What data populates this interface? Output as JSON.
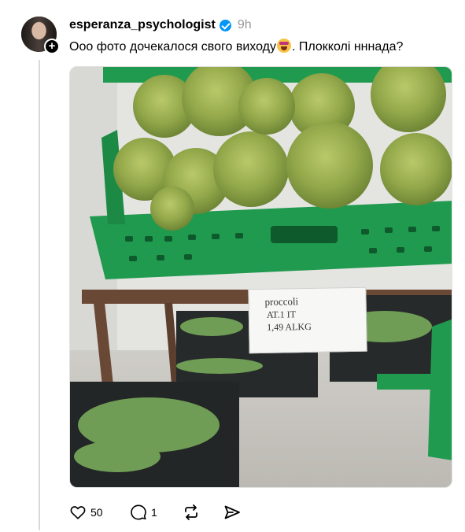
{
  "post": {
    "username": "esperanza_psychologist",
    "time": "9h",
    "text_before_emoji": "Ооо фото дочекалося свого виходу",
    "emoji": "smiling-face-with-hearts",
    "text_after_emoji": ". Плокколі нннада?",
    "photo": {
      "sign_lines": [
        "proccoli",
        "AT.1 IT",
        "1,49 ALKG"
      ]
    }
  },
  "actions": {
    "likes": "50",
    "replies": "1"
  }
}
